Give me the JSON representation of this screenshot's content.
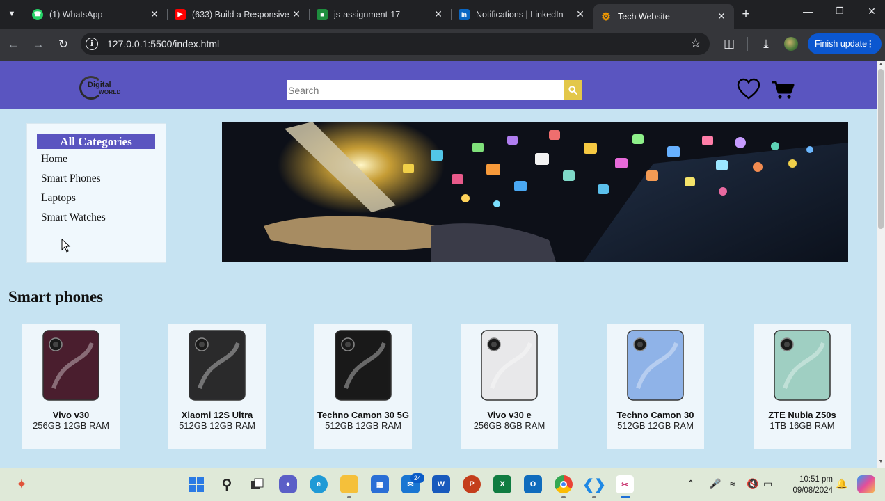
{
  "browser": {
    "tabs": [
      {
        "title": "(1) WhatsApp",
        "icon": "whatsapp-icon",
        "color": "#25d366"
      },
      {
        "title": "(633) Build a Responsive",
        "icon": "youtube-icon",
        "color": "#ff0000"
      },
      {
        "title": "js-assignment-17",
        "icon": "google-classroom-icon",
        "color": "#1e8e3e"
      },
      {
        "title": "Notifications | LinkedIn",
        "icon": "linkedin-icon",
        "color": "#0a66c2"
      },
      {
        "title": "Tech Website",
        "icon": "site-gear-icon",
        "color": "#f29900",
        "active": true
      }
    ],
    "url": "127.0.0.1:5500/index.html",
    "finish_update": "Finish update"
  },
  "site": {
    "logo": {
      "line1": "Digital",
      "line2": "WORLD"
    },
    "search": {
      "placeholder": "Search"
    },
    "brand_color": "#5a55c0",
    "search_button_color": "#e3c74a",
    "categories": {
      "title": "All Categories",
      "items": [
        "Home",
        "Smart Phones",
        "Laptops",
        "Smart Watches"
      ]
    },
    "section_title": "Smart phones",
    "products": [
      {
        "name": "Vivo v30",
        "spec": "256GB 12GB RAM",
        "phone_color": "#4a1e2e"
      },
      {
        "name": "Xiaomi 12S Ultra",
        "spec": "512GB 12GB RAM",
        "phone_color": "#2a2a2c"
      },
      {
        "name": "Techno Camon 30 5G",
        "spec": "512GB 12GB RAM",
        "phone_color": "#1a1a1a"
      },
      {
        "name": "Vivo v30 e",
        "spec": "256GB 8GB RAM",
        "phone_color": "#e8e8ea"
      },
      {
        "name": "Techno Camon 30",
        "spec": "512GB 12GB RAM",
        "phone_color": "#8fb3e8"
      },
      {
        "name": "ZTE Nubia Z50s",
        "spec": "1TB 16GB RAM",
        "phone_color": "#9fcfc2"
      }
    ]
  },
  "taskbar": {
    "time": "10:51 pm",
    "date": "09/08/2024",
    "mail_badge": "24"
  }
}
